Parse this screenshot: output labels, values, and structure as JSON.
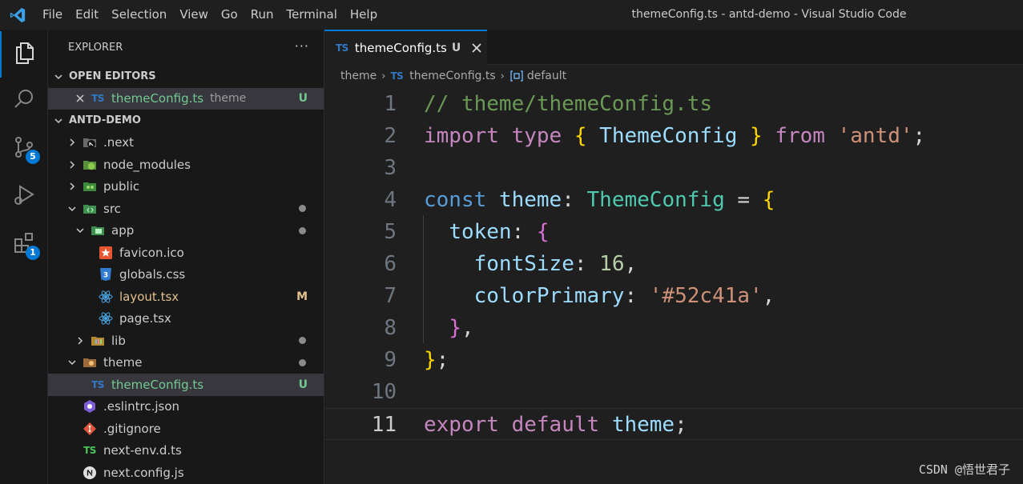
{
  "titlebar": {
    "menu": [
      "File",
      "Edit",
      "Selection",
      "View",
      "Go",
      "Run",
      "Terminal",
      "Help"
    ],
    "window_title": "themeConfig.ts - antd-demo - Visual Studio Code"
  },
  "activitybar": {
    "source_control_badge": "5",
    "extensions_badge": "1"
  },
  "sidebar": {
    "title": "EXPLORER",
    "more": "···",
    "open_editors": {
      "label": "OPEN EDITORS",
      "items": [
        {
          "name": "themeConfig.ts",
          "desc": "theme",
          "status": "U",
          "icon_text": "TS"
        }
      ]
    },
    "project": {
      "label": "ANTD-DEMO",
      "items": [
        {
          "name": ".next",
          "status": ""
        },
        {
          "name": "node_modules",
          "status": ""
        },
        {
          "name": "public",
          "status": ""
        },
        {
          "name": "src",
          "status": "dot"
        },
        {
          "name": "app",
          "status": "dot"
        },
        {
          "name": "favicon.ico",
          "status": ""
        },
        {
          "name": "globals.css",
          "status": ""
        },
        {
          "name": "layout.tsx",
          "status": "M"
        },
        {
          "name": "page.tsx",
          "status": ""
        },
        {
          "name": "lib",
          "status": "dot"
        },
        {
          "name": "theme",
          "status": "dot"
        },
        {
          "name": "themeConfig.ts",
          "status": "U",
          "icon_text": "TS"
        },
        {
          "name": ".eslintrc.json",
          "status": ""
        },
        {
          "name": ".gitignore",
          "status": ""
        },
        {
          "name": "next-env.d.ts",
          "status": "",
          "icon_text": "TS"
        },
        {
          "name": "next.config.js",
          "status": ""
        }
      ]
    }
  },
  "editor": {
    "tab": {
      "icon_text": "TS",
      "label": "themeConfig.ts",
      "status": "U"
    },
    "breadcrumbs": [
      "theme",
      "themeConfig.ts",
      "default"
    ],
    "line_numbers": [
      "1",
      "2",
      "3",
      "4",
      "5",
      "6",
      "7",
      "8",
      "9",
      "10",
      "11"
    ],
    "code": {
      "l1_comment": "// theme/themeConfig.ts",
      "l2_import": "import",
      "l2_type": "type",
      "l2_open": "{",
      "l2_name": "ThemeConfig",
      "l2_close": "}",
      "l2_from": "from",
      "l2_module": "'antd'",
      "l2_semi": ";",
      "l4_const": "const",
      "l4_var": "theme",
      "l4_colon": ":",
      "l4_type": "ThemeConfig",
      "l4_eq": "=",
      "l4_open": "{",
      "l5_key": "token",
      "l5_colon": ":",
      "l5_open": "{",
      "l6_key": "fontSize",
      "l6_colon": ":",
      "l6_val": "16",
      "l6_comma": ",",
      "l7_key": "colorPrimary",
      "l7_colon": ":",
      "l7_val": "'#52c41a'",
      "l7_comma": ",",
      "l8_close": "}",
      "l8_comma": ",",
      "l9_close": "}",
      "l9_semi": ";",
      "l11_export": "export",
      "l11_default": "default",
      "l11_var": "theme",
      "l11_semi": ";"
    }
  },
  "watermark": "CSDN @悟世君子",
  "colors": {
    "accent": "#0078d4",
    "modified": "#e2c08d",
    "untracked": "#73c991"
  }
}
